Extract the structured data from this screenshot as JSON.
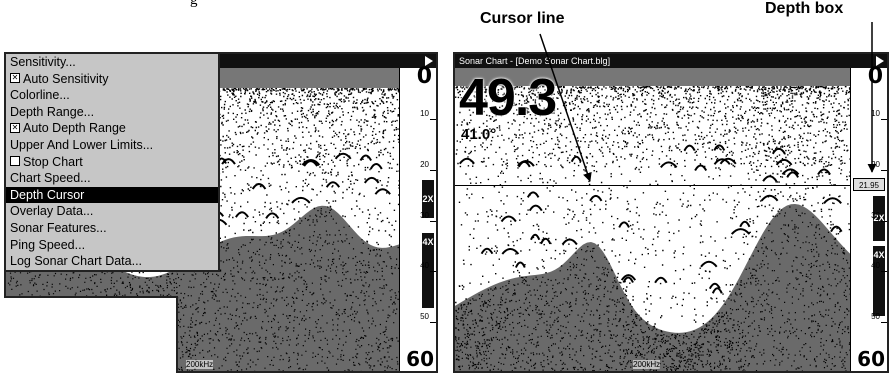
{
  "top_caption": "g",
  "callouts": {
    "cursor_line": "Cursor line",
    "depth_box": "Depth box"
  },
  "left_screen": {
    "menu": {
      "items": [
        {
          "label": "Sensitivity...",
          "checkbox": false
        },
        {
          "label": "Auto Sensitivity",
          "checkbox": true,
          "checked": true
        },
        {
          "label": "Colorline...",
          "checkbox": false
        },
        {
          "label": "Depth Range...",
          "checkbox": false
        },
        {
          "label": "Auto Depth Range",
          "checkbox": true,
          "checked": true
        },
        {
          "label": "Upper And Lower Limits...",
          "checkbox": false
        },
        {
          "label": "Stop Chart",
          "checkbox": true,
          "checked": false
        },
        {
          "label": "Chart Speed...",
          "checkbox": false
        },
        {
          "label": "Depth Cursor",
          "checkbox": false,
          "selected": true
        },
        {
          "label": "Overlay Data...",
          "checkbox": false
        },
        {
          "label": "Sonar Features...",
          "checkbox": false
        },
        {
          "label": "Ping Speed...",
          "checkbox": false
        },
        {
          "label": "Log Sonar Chart Data...",
          "checkbox": false
        }
      ]
    },
    "scale": {
      "top": "0",
      "bottom": "60",
      "ticks": [
        "10",
        "20",
        "30",
        "40",
        "50"
      ]
    },
    "zoom": {
      "z2": "2X",
      "z4": "4X"
    },
    "frequency": "200kHz"
  },
  "right_screen": {
    "title": "Sonar Chart - [Demo Sonar Chart.blg]",
    "depth_readout": "49.3",
    "temperature_readout": "41.0°",
    "depth_box_value": "21.95",
    "scale": {
      "top": "0",
      "bottom": "60",
      "ticks": [
        "10",
        "20",
        "30",
        "40",
        "50"
      ]
    },
    "zoom": {
      "z2": "2X",
      "z4": "4X"
    },
    "frequency": "200kHz"
  },
  "colors": {
    "screen_fg": "#000000",
    "menu_bg": "#c6c6c6",
    "selected_bg": "#000000"
  }
}
